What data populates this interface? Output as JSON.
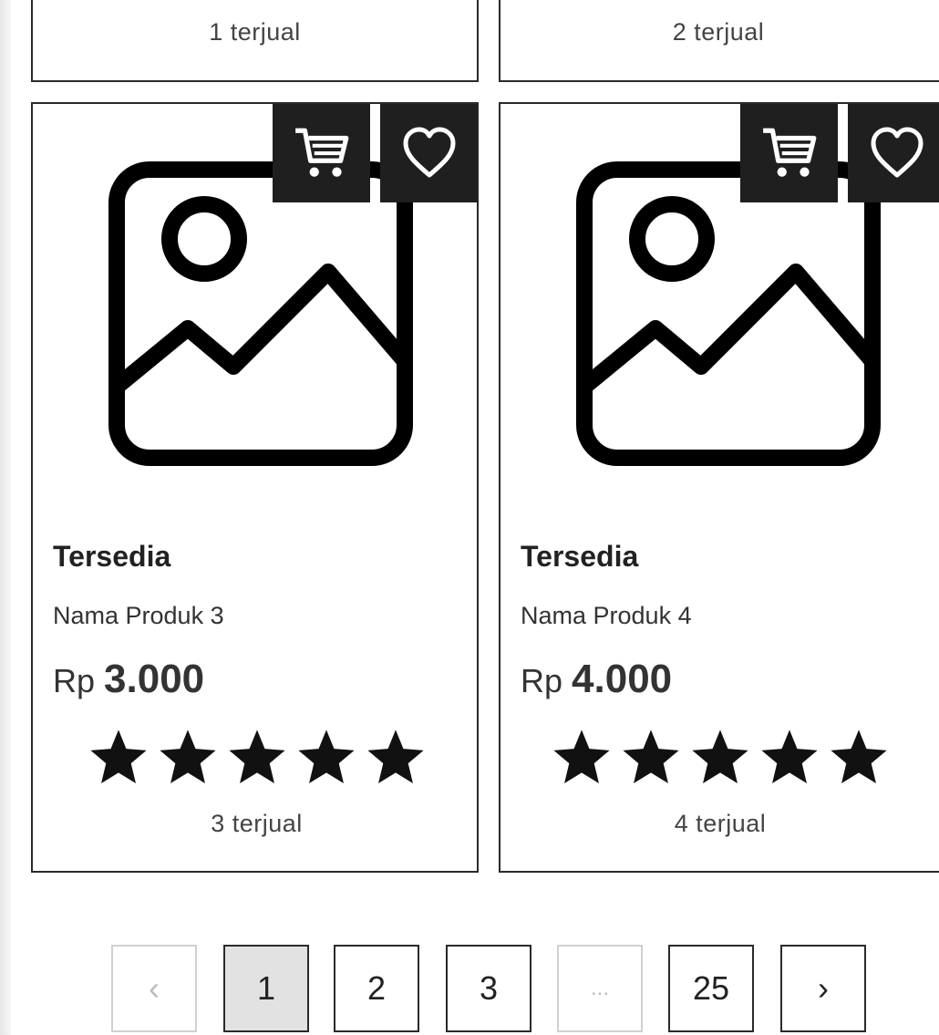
{
  "products": [
    {
      "sold": "1 terjual"
    },
    {
      "sold": "2 terjual"
    },
    {
      "availability": "Tersedia",
      "name": "Nama Produk 3",
      "currency": "Rp",
      "price": "3.000",
      "rating": 5,
      "sold": "3 terjual"
    },
    {
      "availability": "Tersedia",
      "name": "Nama Produk 4",
      "currency": "Rp",
      "price": "4.000",
      "rating": 5,
      "sold": "4 terjual"
    }
  ],
  "pagination": {
    "prev": "‹",
    "pages": [
      "1",
      "2",
      "3"
    ],
    "ellipsis": "...",
    "last": "25",
    "next": "›",
    "current": "1"
  },
  "icons": {
    "cart": "cart-icon",
    "favorite": "heart-icon",
    "placeholder": "image-placeholder-icon",
    "star": "star-icon"
  },
  "colors": {
    "dark": "#1f1f1f",
    "border": "#2a2a2a",
    "active_page": "#e2e2e2",
    "disabled": "#bbbbbb"
  }
}
